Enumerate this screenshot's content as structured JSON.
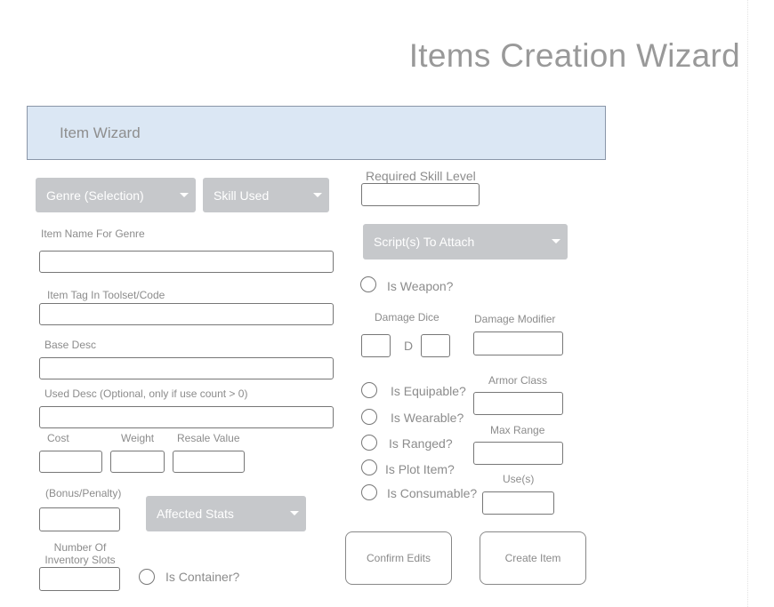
{
  "page": {
    "title": "Items Creation Wizard"
  },
  "banner": {
    "title": "Item Wizard"
  },
  "left": {
    "genre_dropdown": "Genre (Selection)",
    "skill_dropdown": "Skill Used",
    "item_name_label": "Item Name For Genre",
    "item_name_value": "",
    "item_tag_label": "Item Tag In Toolset/Code",
    "item_tag_value": "",
    "base_desc_label": "Base Desc",
    "base_desc_value": "",
    "used_desc_label": "Used Desc (Optional, only if use count > 0)",
    "used_desc_value": "",
    "cost_label": "Cost",
    "weight_label": "Weight",
    "resale_label": "Resale Value",
    "bonus_label": "(Bonus/Penalty)",
    "affected_stats_dropdown": "Affected Stats",
    "inventory_slots_label": "Number Of Inventory Slots",
    "is_container_label": "Is Container?"
  },
  "right": {
    "required_skill_label": "Required Skill Level",
    "scripts_dropdown": "Script(s) To Attach",
    "is_weapon_label": "Is Weapon?",
    "damage_dice_label": "Damage Dice",
    "dice_separator": "D",
    "damage_modifier_label": "Damage Modifier",
    "is_equipable_label": "Is Equipable?",
    "armor_class_label": "Armor Class",
    "is_wearable_label": "Is Wearable?",
    "is_ranged_label": "Is Ranged?",
    "max_range_label": "Max Range",
    "is_plot_item_label": "Is Plot Item?",
    "is_consumable_label": "Is Consumable?",
    "uses_label": "Use(s)",
    "confirm_button": "Confirm Edits",
    "create_button": "Create Item"
  },
  "colors": {
    "banner_bg": "#dbe7f4",
    "dropdown_bg": "#c6c8cb",
    "text": "#8a8a8a"
  }
}
